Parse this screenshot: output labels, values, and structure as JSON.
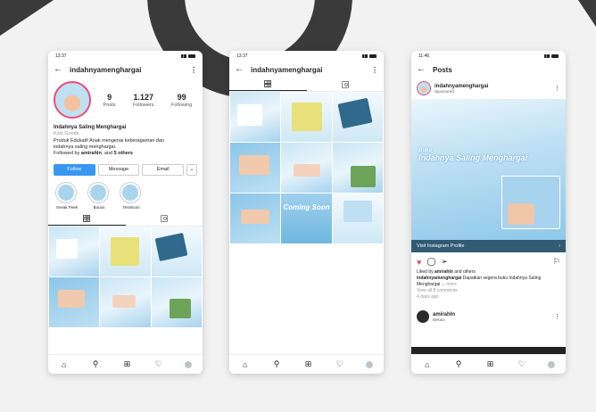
{
  "profile": {
    "time": "13:37",
    "username": "indahnyamenghargai",
    "stats": [
      {
        "num": "9",
        "label": "Posts"
      },
      {
        "num": "1.127",
        "label": "Followers"
      },
      {
        "num": "99",
        "label": "Following"
      }
    ],
    "display_name": "Indahnya Saling Menghargai",
    "category": "Kids Goods",
    "bio_line1": "Produk Edukatif Anak mengenai keberagaman dan",
    "bio_line2": "indahnya saling menghargai.",
    "followed_prefix": "Followed by ",
    "followed_user": "amirahln",
    "followed_mid": ", and ",
    "followed_others": "5 others",
    "buttons": {
      "follow": "Follow",
      "message": "Message",
      "email": "Email",
      "more": "⌄"
    },
    "highlights": [
      "Sneak Peek",
      "Bonus",
      "Testimoni"
    ]
  },
  "feed": {
    "time": "13:37",
    "username": "indahnyamenghargai",
    "coming_soon": "Coming Soon"
  },
  "post": {
    "time": "11:46",
    "title": "Posts",
    "username": "indahnyamenghargai",
    "sponsored": "Sponsored",
    "image_kicker": "Buku",
    "image_title": "Indahnya Saling Menghargai",
    "visit_label": "Visit Instagram Profile",
    "liked_prefix": "Liked by ",
    "liked_user": "amirahln",
    "liked_suffix": " and others",
    "caption_user": "indahnyamenghargai",
    "caption_text": " Dapatkan segera buku Indahnya Saling Menghargai ...",
    "caption_more": "more",
    "view_comments": "View all 8 comments",
    "time_ago": "4 days ago",
    "next_user": "amirahln",
    "next_location": "Bekasi"
  },
  "icons": {
    "back": "←",
    "more_vert": "⋮",
    "home": "⌂",
    "search": "⚲",
    "add": "⊞",
    "heart": "♡",
    "heart_filled": "♥",
    "comment": "◯",
    "share": "➢",
    "bookmark": "⚐",
    "chevron": "›"
  }
}
